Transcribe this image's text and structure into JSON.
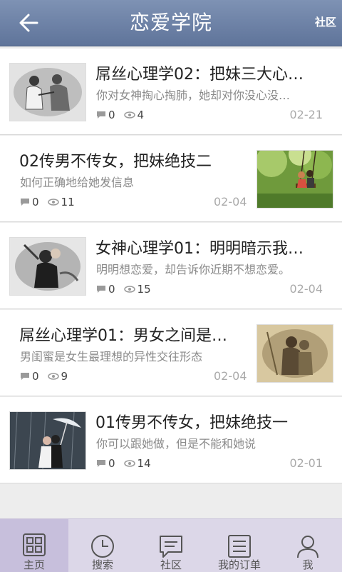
{
  "header": {
    "title": "恋爱学院",
    "right_link": "社区",
    "back_icon": "arrow-left-icon"
  },
  "articles": [
    {
      "title": "屌丝心理学02：把妹三大心…",
      "summary": "你对女神掏心掏肺，她却对你没心没…",
      "comments": "0",
      "views": "4",
      "date": "02-21",
      "thumb_side": "left",
      "image": "sketch-couple-photo"
    },
    {
      "title": "02传男不传女，把妹绝技二",
      "summary": "如何正确地给她发信息",
      "comments": "0",
      "views": "11",
      "date": "02-04",
      "thumb_side": "right",
      "image": "swing-couple-photo"
    },
    {
      "title": "女神心理学01：明明暗示我…",
      "summary": "明明想恋爱，却告诉你近期不想恋爱。",
      "comments": "0",
      "views": "15",
      "date": "02-04",
      "thumb_side": "left",
      "image": "bw-couple-photo"
    },
    {
      "title": "屌丝心理学01：男女之间是…",
      "summary": "男闺蜜是女生最理想的异性交往形态",
      "comments": "0",
      "views": "9",
      "date": "02-04",
      "thumb_side": "right",
      "image": "sepia-couple-photo"
    },
    {
      "title": "01传男不传女，把妹绝技一",
      "summary": "你可以跟她做，但是不能和她说",
      "comments": "0",
      "views": "14",
      "date": "02-01",
      "thumb_side": "left",
      "image": "umbrella-rain-photo"
    }
  ],
  "tabs": [
    {
      "label": "主页",
      "icon": "grid-home-icon",
      "active": true
    },
    {
      "label": "搜索",
      "icon": "clock-icon",
      "active": false
    },
    {
      "label": "社区",
      "icon": "chat-bubble-icon",
      "active": false
    },
    {
      "label": "我的订单",
      "icon": "list-order-icon",
      "active": false
    },
    {
      "label": "我",
      "icon": "person-icon",
      "active": false
    }
  ],
  "colors": {
    "header_bg": "#6a7fa5",
    "tabbar_bg": "#dcd7e8",
    "text_primary": "#222222",
    "text_secondary": "#8a8a8a",
    "date": "#aaaaaa"
  }
}
